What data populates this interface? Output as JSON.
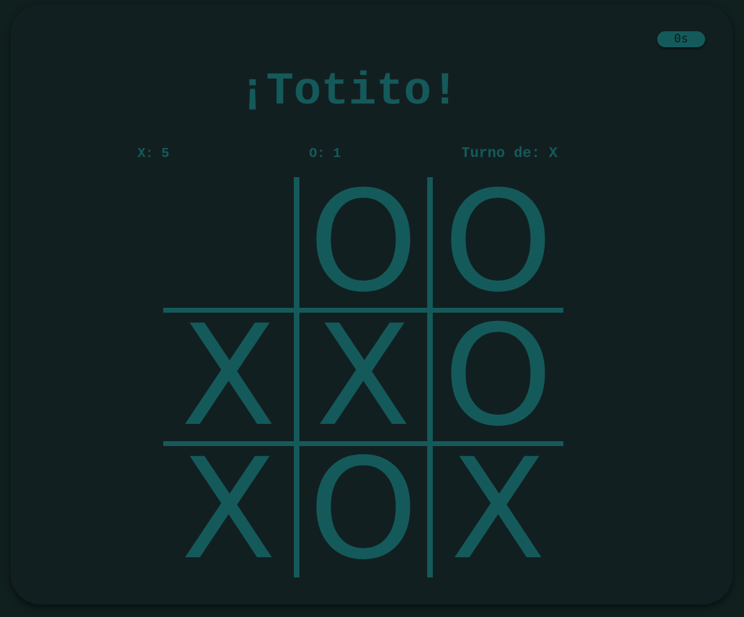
{
  "timer": {
    "label": "0s"
  },
  "title": "¡Totito!",
  "scores": {
    "x": "X: 5",
    "o": "O: 1",
    "turn": "Turno de: X"
  },
  "board": {
    "cells": [
      "",
      "O",
      "O",
      "X",
      "X",
      "O",
      "X",
      "O",
      "X"
    ]
  },
  "colors": {
    "background": "#121f20",
    "accent": "#155a5b"
  }
}
